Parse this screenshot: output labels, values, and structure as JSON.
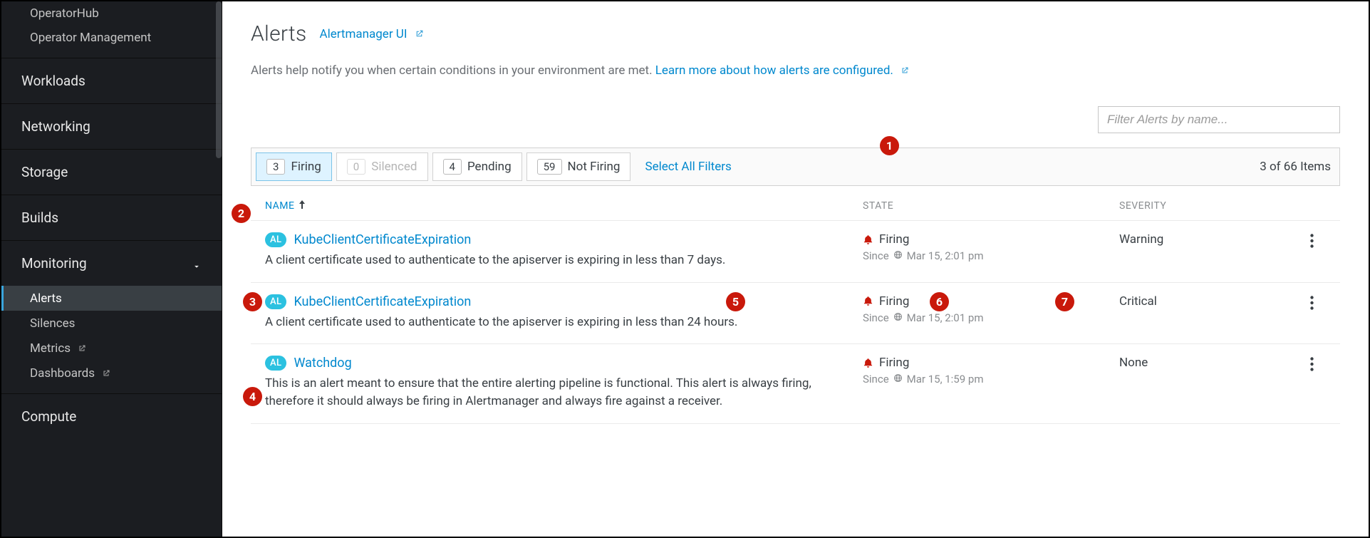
{
  "sidebar": {
    "top_small": [
      {
        "label": "OperatorHub"
      },
      {
        "label": "Operator Management"
      }
    ],
    "primary": [
      {
        "label": "Workloads"
      },
      {
        "label": "Networking"
      },
      {
        "label": "Storage"
      },
      {
        "label": "Builds"
      }
    ],
    "monitoring": {
      "label": "Monitoring",
      "items": [
        {
          "label": "Alerts",
          "active": true
        },
        {
          "label": "Silences"
        },
        {
          "label": "Metrics",
          "external": true
        },
        {
          "label": "Dashboards",
          "external": true
        }
      ]
    },
    "compute": {
      "label": "Compute"
    }
  },
  "page": {
    "title": "Alerts",
    "am_link": "Alertmanager UI",
    "help_prefix": "Alerts help notify you when certain conditions in your environment are met. ",
    "help_link": "Learn more about how alerts are configured."
  },
  "filter": {
    "placeholder": "Filter Alerts by name...",
    "chips": [
      {
        "count": "3",
        "label": "Firing",
        "state": "active"
      },
      {
        "count": "0",
        "label": "Silenced",
        "state": "disabled"
      },
      {
        "count": "4",
        "label": "Pending",
        "state": "normal"
      },
      {
        "count": "59",
        "label": "Not Firing",
        "state": "normal"
      }
    ],
    "select_all": "Select All Filters",
    "item_count": "3 of 66 Items"
  },
  "columns": {
    "name": "NAME",
    "state": "STATE",
    "severity": "SEVERITY"
  },
  "alerts": [
    {
      "badge": "AL",
      "name": "KubeClientCertificateExpiration",
      "desc": "A client certificate used to authenticate to the apiserver is expiring in less than 7 days.",
      "state": "Firing",
      "since_prefix": "Since",
      "since_time": "Mar 15, 2:01 pm",
      "severity": "Warning"
    },
    {
      "badge": "AL",
      "name": "KubeClientCertificateExpiration",
      "desc": "A client certificate used to authenticate to the apiserver is expiring in less than 24 hours.",
      "state": "Firing",
      "since_prefix": "Since",
      "since_time": "Mar 15, 2:01 pm",
      "severity": "Critical"
    },
    {
      "badge": "AL",
      "name": "Watchdog",
      "desc": "This is an alert meant to ensure that the entire alerting pipeline is functional. This alert is always firing, therefore it should always be firing in Alertmanager and always fire against a receiver.",
      "state": "Firing",
      "since_prefix": "Since",
      "since_time": "Mar 15, 1:59 pm",
      "severity": "None"
    }
  ],
  "annotations": [
    "1",
    "2",
    "3",
    "4",
    "5",
    "6",
    "7"
  ]
}
